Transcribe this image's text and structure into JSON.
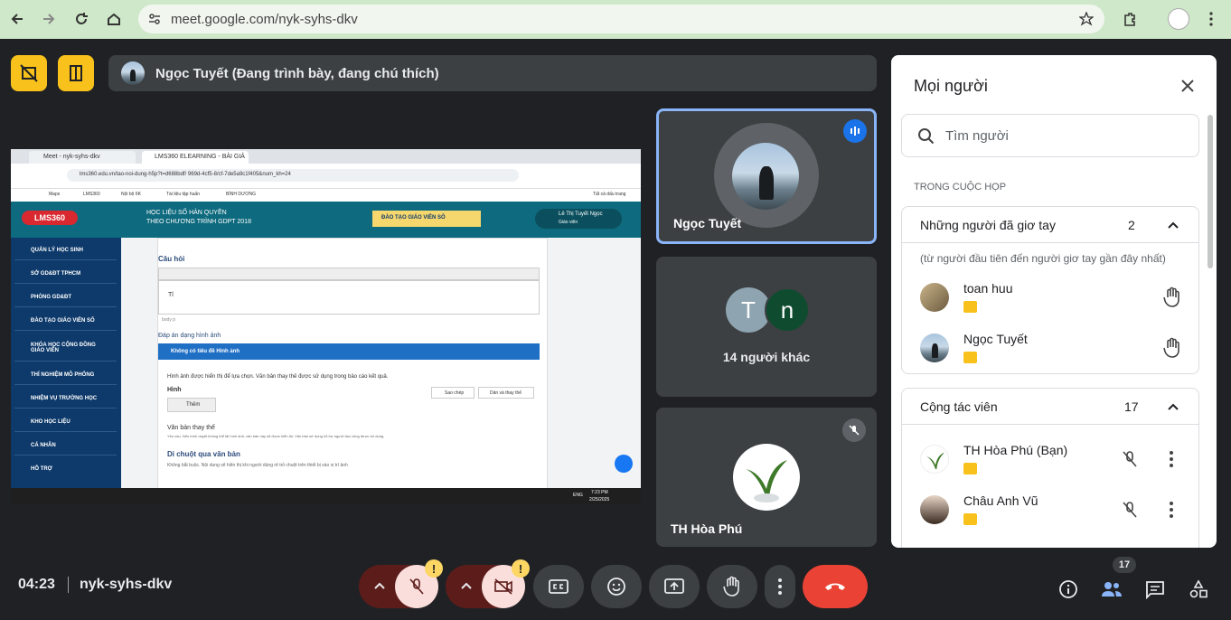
{
  "browser": {
    "url": "meet.google.com/nyk-syhs-dkv"
  },
  "presentation": {
    "presenter_label": "Ngọc Tuyết (Đang trình bày, đang chú thích)"
  },
  "shared_screen": {
    "tab1": "Meet - nyk-syhs-dkv",
    "tab2": "LMS360 ELEARNING - BÀI GIẢ",
    "url": "lms360.edu.vn/tao-noi-dung-h5p?t=d688bdf/ 969d-4cf5-8/cf-7de5a9c1f405&num_kh=24",
    "bookmarks": [
      "Maps",
      "LMS360",
      "Nội bộ 6K",
      "Tài liệu tập huấn",
      "BÌNH DƯƠNG",
      "Tất cả dấu trang"
    ],
    "header_title_1": "HỌC LIỆU SỐ HẢN QUYỀN",
    "header_title_2": "THEO CHƯƠNG TRÌNH GDPT 2018",
    "banner": "ĐÀO TẠO GIÁO VIÊN SỐ",
    "user_name": "Lê Thị Tuyết Ngọc",
    "user_role": "Giáo viên",
    "sidebar": [
      "QUẢN LÝ HỌC SINH",
      "SỞ GD&ĐT TPHCM",
      "PHÒNG GD&ĐT",
      "ĐÀO TẠO GIÁO VIÊN SỐ",
      "KHÓA HỌC CỘNG ĐỒNG GIÁO VIÊN",
      "THÍ NGHIỆM MÔ PHỎNG",
      "NHIỆM VỤ TRƯỜNG HỌC",
      "KHO HỌC LIỆU",
      "CÁ NHÂN",
      "HỖ TRỢ"
    ],
    "question_label": "Câu hỏi",
    "editor_text": "Tl",
    "editor_footer": "body p",
    "answer_label": "Đáp án dạng hình ảnh",
    "blue_bar": "Không có tiêu đề Hình ảnh",
    "desc": "Hình ảnh được hiển thị để lựa chọn. Văn bản thay thế được sử dụng trong bảo cáo kết quả.",
    "image_label": "Hình",
    "copy_btn": "Sao chép",
    "paste_btn": "Dán và thay thế",
    "add_btn": "Thêm",
    "alt_label": "Văn bản thay thế",
    "alt_desc": "Yêu cầu. Nếu trình duyệt không thể tải hình ảnh, văn bản này sẽ được hiển thị. Văn bản sử dụng hỗ trợ người đọc công được sử dụng.",
    "hover_label": "Di chuột qua văn bản",
    "hover_desc": "Không bắt buộc. Nội dung sẽ hiển thị khi người dùng rê trỏ chuột trên thiết bị vào vị trí ảnh",
    "taskbar_time": "7:23 PM",
    "taskbar_date": "2/25/2025",
    "taskbar_lang": "ENG"
  },
  "tiles": {
    "tile1_name": "Ngọc Tuyết",
    "tile2_avatar1": "T",
    "tile2_avatar2": "n",
    "tile2_label": "14 người khác",
    "tile3_name": "TH Hòa Phú"
  },
  "panel": {
    "title": "Mọi người",
    "search_placeholder": "Tìm người",
    "in_meeting": "TRONG CUỘC HỌP",
    "raised": {
      "title": "Những người đã giơ tay",
      "count": "2",
      "note": "(từ người đầu tiên đến người giơ tay gần đây nhất)",
      "people": [
        {
          "name": "toan huu"
        },
        {
          "name": "Ngọc Tuyết"
        }
      ]
    },
    "collab": {
      "title": "Cộng tác viên",
      "count": "17",
      "people": [
        {
          "name": "TH Hòa Phú (Bạn)"
        },
        {
          "name": "Châu Anh Vũ"
        }
      ]
    }
  },
  "bottom": {
    "time": "04:23",
    "meeting_code": "nyk-syhs-dkv",
    "people_count": "17",
    "warn": "!"
  },
  "colors": {
    "accent_yellow": "#f9c11b",
    "end_call_red": "#ea4335",
    "active_blue": "#8ab4f8",
    "lms_blue": "#0e3a6b"
  }
}
